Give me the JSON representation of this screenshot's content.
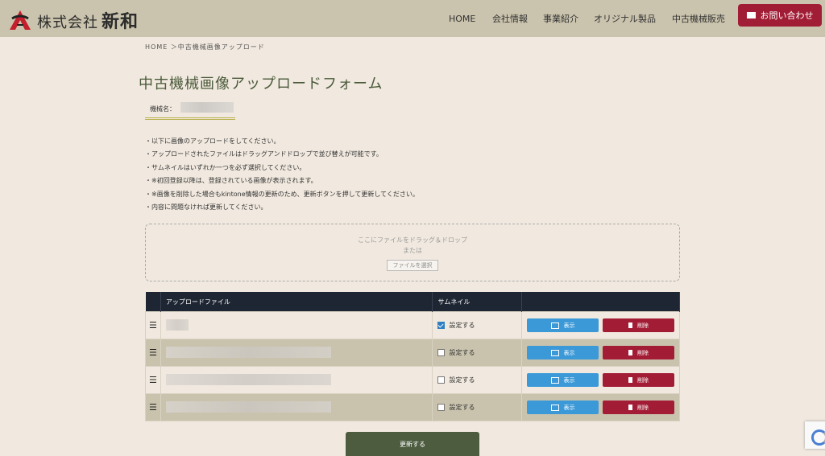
{
  "header": {
    "logo_text": "株式会社",
    "logo_name": "新和",
    "nav": [
      "HOME",
      "会社情報",
      "事業紹介",
      "オリジナル製品",
      "中古機械販売"
    ],
    "contact_label": "お問い合わせ"
  },
  "breadcrumb": "HOME ＞中古機械画像アップロード",
  "page_title": "中古機械画像アップロードフォーム",
  "machine_label": "機械名：",
  "notes": [
    "・以下に画像のアップロードをしてください。",
    "・アップロードされたファイルはドラッグアンドドロップで並び替えが可能です。",
    "・サムネイルはいずれか一つを必ず選択してください。",
    "・※初回登録以降は、登録されている画像が表示されます。",
    "・※画像を削除した場合もkintone情報の更新のため、更新ボタンを押して更新してください。",
    "・内容に問題なければ更新してください。"
  ],
  "dropzone": {
    "line1": "ここにファイルをドラッグ＆ドロップ",
    "line2": "または",
    "button": "ファイルを選択"
  },
  "table": {
    "headers": [
      "アップロードファイル",
      "サムネイル",
      ""
    ],
    "rows": [
      {
        "checked": true,
        "thumb_label": "設定する",
        "show": "表示",
        "delete": "削除"
      },
      {
        "checked": false,
        "thumb_label": "設定する",
        "show": "表示",
        "delete": "削除"
      },
      {
        "checked": false,
        "thumb_label": "設定する",
        "show": "表示",
        "delete": "削除"
      },
      {
        "checked": false,
        "thumb_label": "設定する",
        "show": "表示",
        "delete": "削除"
      }
    ]
  },
  "update_button": "更新する",
  "colors": {
    "header_bg": "#cac3ad",
    "page_bg": "#f1e9df",
    "accent_red": "#a11d35",
    "table_head": "#1e2633",
    "show_blue": "#3b99d8",
    "update_green": "#4d5c3f"
  }
}
